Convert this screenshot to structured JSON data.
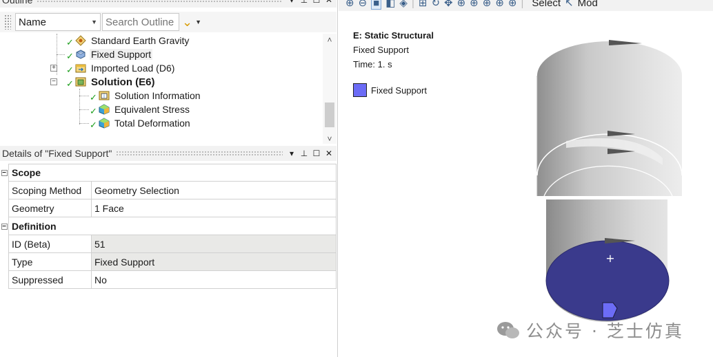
{
  "outline": {
    "title": "Outline",
    "controls": {
      "dropdown": "▾",
      "pin": "⊥",
      "maximize": "☐",
      "close": "✕"
    },
    "name_filter": "Name",
    "search_placeholder": "Search Outline",
    "tree": [
      {
        "label": "Standard Earth Gravity",
        "icon": "gravity-icon"
      },
      {
        "label": "Fixed Support",
        "icon": "support-icon",
        "selected": true
      },
      {
        "label": "Imported Load (D6)",
        "icon": "imported-load-icon",
        "expander": "+"
      },
      {
        "label": "Solution (E6)",
        "icon": "solution-icon",
        "expander": "−",
        "bold": true
      },
      {
        "label": "Solution Information",
        "icon": "info-icon"
      },
      {
        "label": "Equivalent Stress",
        "icon": "result-icon"
      },
      {
        "label": "Total Deformation",
        "icon": "result-icon"
      }
    ]
  },
  "details": {
    "title": "Details of \"Fixed Support\"",
    "groups": [
      {
        "name": "Scope",
        "rows": [
          {
            "name": "Scoping Method",
            "value": "Geometry Selection"
          },
          {
            "name": "Geometry",
            "value": "1 Face"
          }
        ]
      },
      {
        "name": "Definition",
        "rows": [
          {
            "name": "ID (Beta)",
            "value": "51",
            "grey": true
          },
          {
            "name": "Type",
            "value": "Fixed Support",
            "grey": true
          },
          {
            "name": "Suppressed",
            "value": "No"
          }
        ]
      }
    ]
  },
  "graphics": {
    "toolbar_select": "Select",
    "toolbar_mode": "Mod",
    "legend": {
      "title": "E: Static Structural",
      "subtitle": "Fixed Support",
      "time": "Time: 1. s",
      "item": "Fixed Support",
      "swatch_color": "#6c6cf6"
    },
    "support_face_color": "#3a3a8c"
  },
  "watermark": "公众号 · 芝士仿真"
}
